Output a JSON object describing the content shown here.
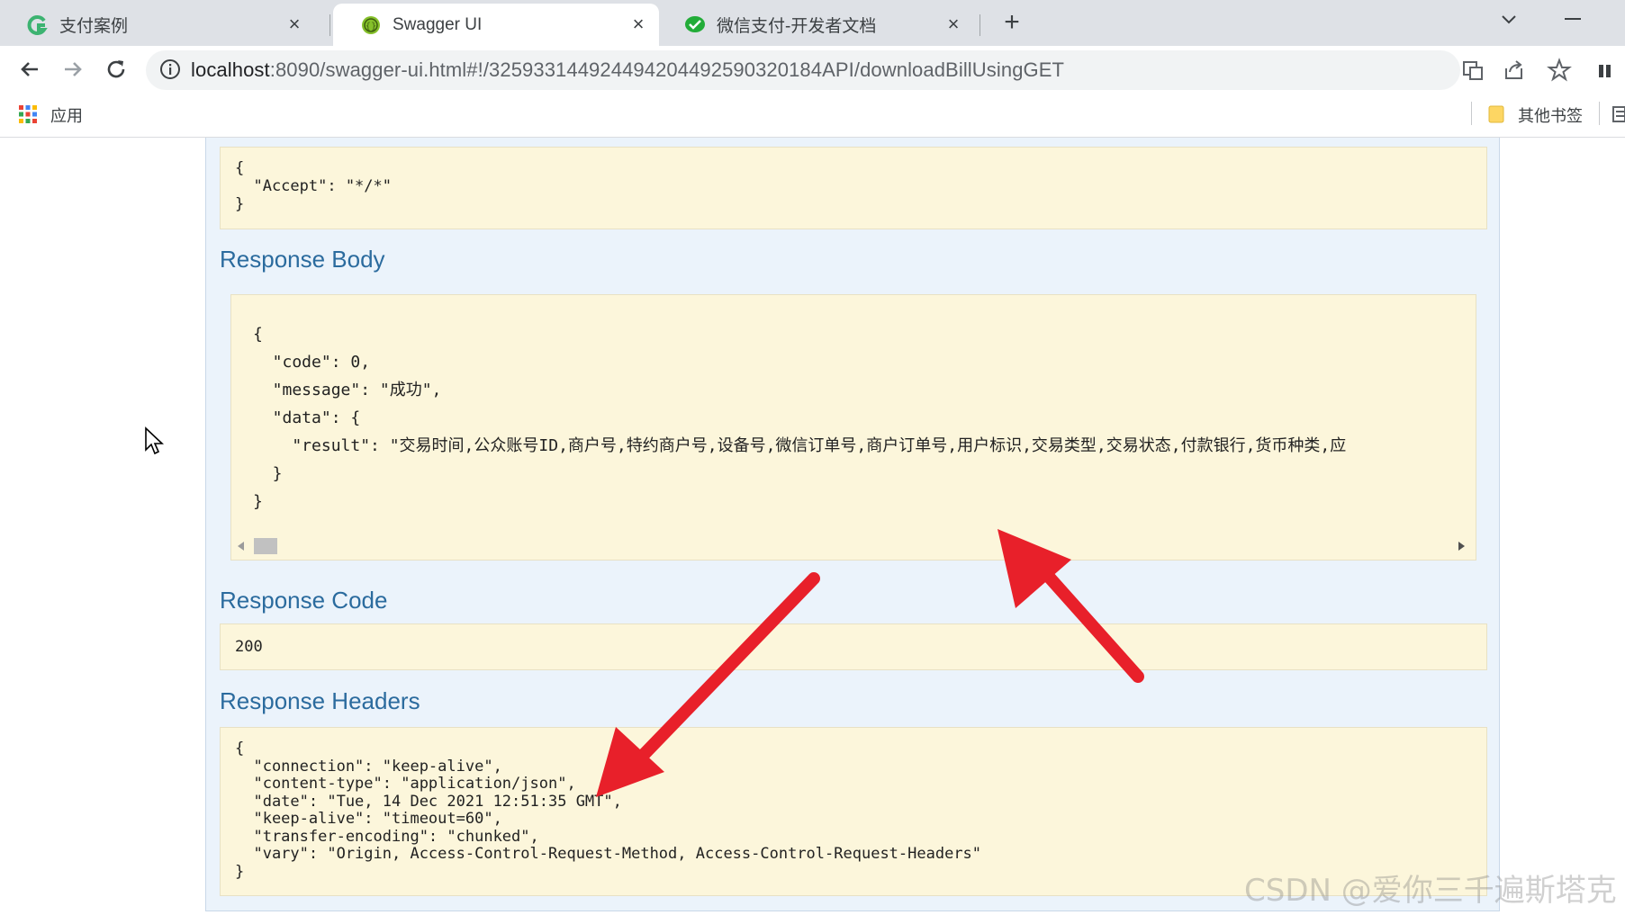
{
  "browser": {
    "tabs": [
      {
        "title": "支付案例",
        "icon": "green-c-icon"
      },
      {
        "title": "Swagger UI",
        "icon": "swagger-icon"
      },
      {
        "title": "微信支付-开发者文档",
        "icon": "wechat-icon"
      }
    ],
    "address": {
      "host": "localhost",
      "path": ":8090/swagger-ui.html#!/325933144924494204492590320184API/downloadBillUsingGET"
    },
    "bookmarks": {
      "apps_label": "应用",
      "other_label": "其他书签"
    }
  },
  "request_headers_code": "{\n  \"Accept\": \"*/*\"\n}",
  "response_body": {
    "title": "Response Body",
    "code": "{\n  \"code\": 0,\n  \"message\": \"成功\",\n  \"data\": {\n    \"result\": \"交易时间,公众账号ID,商户号,特约商户号,设备号,微信订单号,商户订单号,用户标识,交易类型,交易状态,付款银行,货币种类,应\n  }\n}"
  },
  "response_code": {
    "title": "Response Code",
    "value": "200"
  },
  "response_headers": {
    "title": "Response Headers",
    "code": "{\n  \"connection\": \"keep-alive\",\n  \"content-type\": \"application/json\",\n  \"date\": \"Tue, 14 Dec 2021 12:51:35 GMT\",\n  \"keep-alive\": \"timeout=60\",\n  \"transfer-encoding\": \"chunked\",\n  \"vary\": \"Origin, Access-Control-Request-Method, Access-Control-Request-Headers\"\n}"
  },
  "watermark": "CSDN @爱你三千遍斯塔克",
  "colors": {
    "annotation_arrow": "#e8202a",
    "section_title": "#2b6b9e",
    "code_background": "#fcf6db"
  }
}
